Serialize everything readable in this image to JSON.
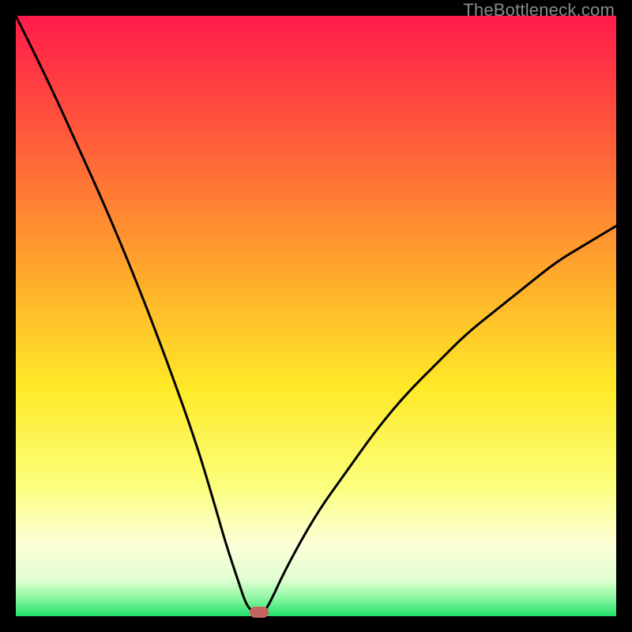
{
  "watermark": "TheBottleneck.com",
  "chart_data": {
    "type": "line",
    "title": "",
    "xlabel": "",
    "ylabel": "",
    "xlim": [
      0,
      100
    ],
    "ylim": [
      0,
      100
    ],
    "grid": false,
    "legend": false,
    "gradient_stops": [
      {
        "pct": 0,
        "color": "#ff1b4a"
      },
      {
        "pct": 20,
        "color": "#ff5a3a"
      },
      {
        "pct": 45,
        "color": "#ffb02a"
      },
      {
        "pct": 62,
        "color": "#ffe928"
      },
      {
        "pct": 78,
        "color": "#fbff7a"
      },
      {
        "pct": 88,
        "color": "#fdffd8"
      },
      {
        "pct": 94,
        "color": "#e0ffd0"
      },
      {
        "pct": 97,
        "color": "#8cf7a0"
      },
      {
        "pct": 100,
        "color": "#22e06a"
      }
    ],
    "series": [
      {
        "name": "bottleneck-curve",
        "x": [
          0,
          5,
          10,
          15,
          20,
          25,
          30,
          33,
          35,
          37,
          38.5,
          40,
          41,
          42,
          45,
          50,
          55,
          60,
          65,
          70,
          75,
          80,
          85,
          90,
          95,
          100
        ],
        "y": [
          100,
          90,
          79,
          68,
          56,
          43,
          29,
          19,
          12,
          6,
          1.5,
          0.5,
          0.5,
          1.5,
          8,
          17,
          24,
          31,
          37,
          42,
          47,
          51,
          55,
          59,
          62,
          65
        ]
      }
    ],
    "marker": {
      "x": 40.5,
      "y": 0.6,
      "color": "#c76460"
    }
  }
}
